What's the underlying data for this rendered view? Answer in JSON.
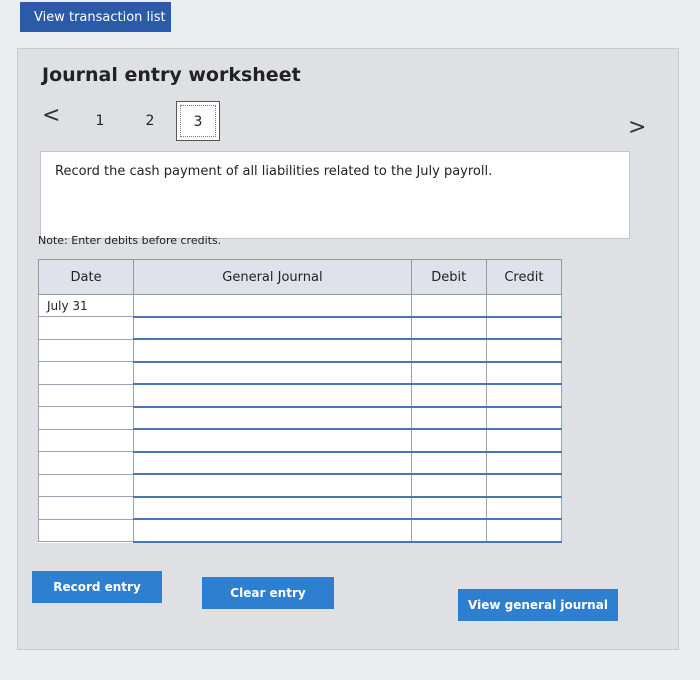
{
  "top_button": "View transaction list",
  "title": "Journal entry worksheet",
  "nav": {
    "prev": "<",
    "next": ">"
  },
  "tabs": [
    "1",
    "2",
    "3"
  ],
  "instruction": "Record the cash payment of all liabilities related to the July payroll.",
  "note": "Note: Enter debits before credits.",
  "table": {
    "headers": {
      "date": "Date",
      "journal": "General Journal",
      "debit": "Debit",
      "credit": "Credit"
    },
    "rows": [
      {
        "date": "July 31"
      },
      {
        "date": ""
      },
      {
        "date": ""
      },
      {
        "date": ""
      },
      {
        "date": ""
      },
      {
        "date": ""
      },
      {
        "date": ""
      },
      {
        "date": ""
      },
      {
        "date": ""
      },
      {
        "date": ""
      },
      {
        "date": ""
      }
    ]
  },
  "buttons": {
    "record": "Record entry",
    "clear": "Clear entry",
    "view_journal": "View general journal"
  },
  "colors": {
    "primary_button": "#2f7fd1",
    "top_button": "#2b5aa8"
  }
}
